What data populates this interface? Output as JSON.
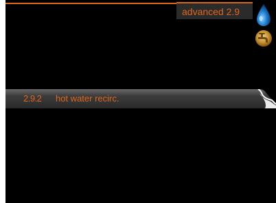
{
  "header": {
    "title": "advanced 2.9"
  },
  "icons": {
    "status_top": "water-drop-icon",
    "status_second": "hot-water-tap-icon"
  },
  "menu": {
    "items": [
      {
        "number": "2.9.2",
        "label": "hot water recirc.",
        "selected": true
      }
    ]
  },
  "colors": {
    "accent": "#e0661c",
    "background": "#000000",
    "row_highlight": "#3a3a3a",
    "drop_blue": "#1e7fd0"
  }
}
